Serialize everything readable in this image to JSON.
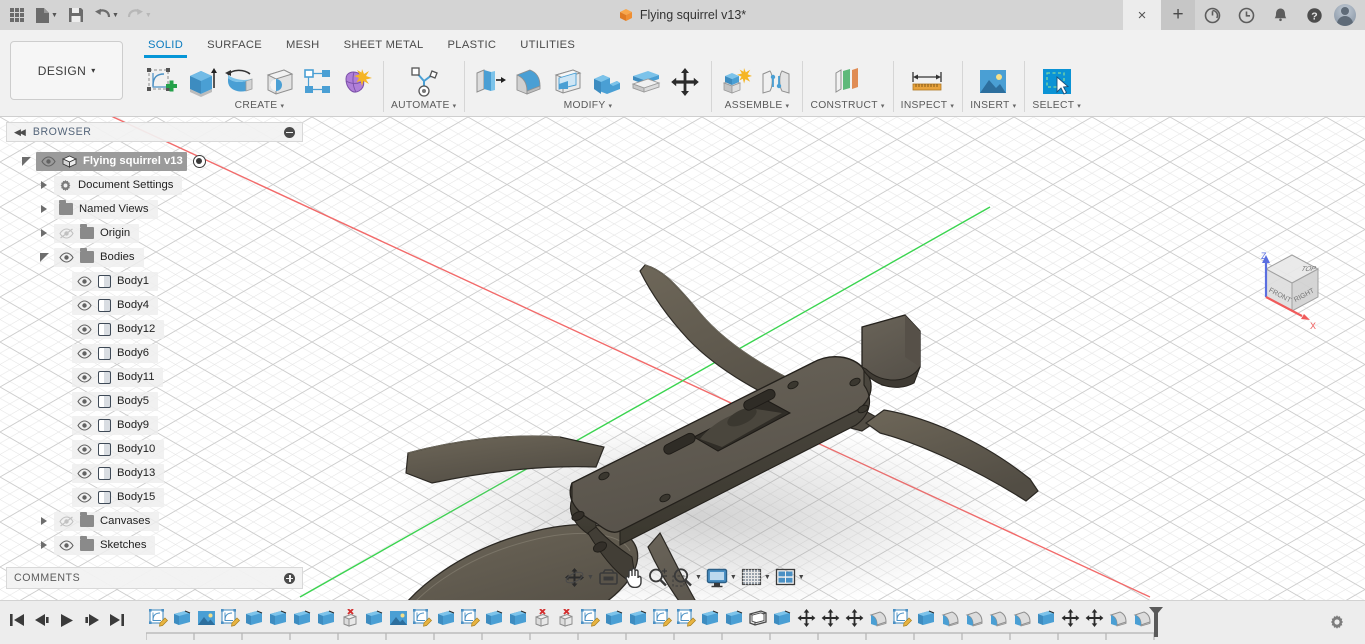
{
  "titlebar": {
    "app_grid_icon": "app-grid-icon",
    "new_doc_icon": "new-document-icon",
    "save_icon": "save-icon",
    "undo_icon": "undo-icon",
    "redo_icon": "redo-icon",
    "document_title": "Flying squirrel v13*",
    "doc_cube_icon": "fusion-cube-icon",
    "close_label": "×",
    "new_tab_label": "+",
    "icons": [
      "recent-activity-icon",
      "job-status-icon",
      "notifications-bell-icon",
      "help-question-icon",
      "user-avatar"
    ]
  },
  "ribbon": {
    "design_label": "DESIGN",
    "design_caret": "▾",
    "tabs": [
      {
        "label": "SOLID",
        "active": true
      },
      {
        "label": "SURFACE",
        "active": false
      },
      {
        "label": "MESH",
        "active": false
      },
      {
        "label": "SHEET METAL",
        "active": false
      },
      {
        "label": "PLASTIC",
        "active": false
      },
      {
        "label": "UTILITIES",
        "active": false
      }
    ],
    "groups": [
      {
        "label": "CREATE",
        "caret": "▾",
        "tools": [
          "create-sketch-icon",
          "extrude-icon",
          "revolve-icon",
          "sweep-icon",
          "pattern-icon",
          "form-icon"
        ]
      },
      {
        "label": "AUTOMATE",
        "caret": "▾",
        "tools": [
          "automate-icon"
        ]
      },
      {
        "label": "MODIFY",
        "caret": "▾",
        "tools": [
          "press-pull-icon",
          "fillet-icon",
          "shell-icon",
          "combine-icon",
          "offset-face-icon",
          "move-copy-icon"
        ]
      },
      {
        "label": "ASSEMBLE",
        "caret": "▾",
        "tools": [
          "new-component-icon",
          "joint-icon"
        ]
      },
      {
        "label": "CONSTRUCT",
        "caret": "▾",
        "tools": [
          "construct-plane-icon"
        ]
      },
      {
        "label": "INSPECT",
        "caret": "▾",
        "tools": [
          "measure-icon"
        ]
      },
      {
        "label": "INSERT",
        "caret": "▾",
        "tools": [
          "insert-image-icon"
        ]
      },
      {
        "label": "SELECT",
        "caret": "▾",
        "tools": [
          "select-window-icon"
        ]
      }
    ]
  },
  "browser": {
    "title": "BROWSER",
    "collapse_icon": "collapse-left-icon",
    "minimize_icon": "minimize-panel-icon",
    "tree": [
      {
        "label": "Flying squirrel v13",
        "level": 0,
        "expander": "open",
        "eye": "visible",
        "icon": "component-cube-icon",
        "root": true,
        "radio": true
      },
      {
        "label": "Document Settings",
        "level": 1,
        "expander": "closed",
        "eye": "none",
        "icon": "gear-icon"
      },
      {
        "label": "Named Views",
        "level": 1,
        "expander": "closed",
        "eye": "none",
        "icon": "folder-icon"
      },
      {
        "label": "Origin",
        "level": 1,
        "expander": "closed",
        "eye": "hidden",
        "icon": "folder-icon"
      },
      {
        "label": "Bodies",
        "level": 1,
        "expander": "open",
        "eye": "visible",
        "icon": "folder-icon"
      },
      {
        "label": "Body1",
        "level": 2,
        "expander": "none",
        "eye": "visible",
        "icon": "body-icon"
      },
      {
        "label": "Body4",
        "level": 2,
        "expander": "none",
        "eye": "visible",
        "icon": "body-icon"
      },
      {
        "label": "Body12",
        "level": 2,
        "expander": "none",
        "eye": "visible",
        "icon": "body-icon"
      },
      {
        "label": "Body6",
        "level": 2,
        "expander": "none",
        "eye": "visible",
        "icon": "body-icon"
      },
      {
        "label": "Body11",
        "level": 2,
        "expander": "none",
        "eye": "visible",
        "icon": "body-icon"
      },
      {
        "label": "Body5",
        "level": 2,
        "expander": "none",
        "eye": "visible",
        "icon": "body-icon"
      },
      {
        "label": "Body9",
        "level": 2,
        "expander": "none",
        "eye": "visible",
        "icon": "body-icon"
      },
      {
        "label": "Body10",
        "level": 2,
        "expander": "none",
        "eye": "visible",
        "icon": "body-icon"
      },
      {
        "label": "Body13",
        "level": 2,
        "expander": "none",
        "eye": "visible",
        "icon": "body-icon"
      },
      {
        "label": "Body15",
        "level": 2,
        "expander": "none",
        "eye": "visible",
        "icon": "body-icon"
      },
      {
        "label": "Canvases",
        "level": 1,
        "expander": "closed",
        "eye": "hidden",
        "icon": "folder-icon"
      },
      {
        "label": "Sketches",
        "level": 1,
        "expander": "closed",
        "eye": "visible",
        "icon": "folder-icon"
      }
    ]
  },
  "comments": {
    "title": "COMMENTS",
    "add_icon": "add-comment-icon"
  },
  "viewbar": {
    "items": [
      {
        "name": "orbit-icon",
        "caret": true
      },
      {
        "name": "look-at-icon",
        "caret": false
      },
      {
        "name": "pan-hand-icon",
        "caret": false
      },
      {
        "name": "zoom-icon",
        "caret": false
      },
      {
        "name": "zoom-window-icon",
        "caret": true
      },
      {
        "name": "display-settings-icon",
        "caret": true
      },
      {
        "name": "grid-snaps-icon",
        "caret": true
      },
      {
        "name": "viewports-icon",
        "caret": true
      }
    ]
  },
  "viewcube": {
    "faces": [
      "TOP",
      "FRONT",
      "RIGHT"
    ],
    "axis_z": "Z",
    "axis_x": "X"
  },
  "timeline": {
    "nav": [
      "go-to-beginning-icon",
      "step-back-icon",
      "play-icon",
      "step-forward-icon",
      "go-to-end-icon"
    ],
    "features": [
      "sketch",
      "extrude",
      "canvas",
      "sketch",
      "extrude",
      "extrude",
      "extrude",
      "extrude",
      "delete",
      "extrude",
      "canvas",
      "sketch",
      "extrude",
      "sketch",
      "extrude",
      "extrude",
      "delete",
      "delete",
      "sketch",
      "extrude",
      "extrude",
      "sketch",
      "sketch",
      "extrude",
      "extrude",
      "shell",
      "extrude",
      "move",
      "move",
      "move",
      "fillet",
      "sketch",
      "extrude",
      "fillet",
      "fillet",
      "fillet",
      "fillet",
      "extrude",
      "move",
      "move",
      "fillet",
      "fillet"
    ],
    "marker": "timeline-playhead",
    "settings_icon": "timeline-settings-gear-icon"
  },
  "colors": {
    "accent": "#0696d7",
    "tab_active_text": "#0a7bbf",
    "model_body": "#5c574f",
    "model_dark": "#4a463f",
    "axis_x": "#f05b5b",
    "axis_y": "#35d04a",
    "canvas_bg": "#ffffff",
    "grid_line": "#c9c9c9",
    "ribbon_bg": "#f1f1f1",
    "titlebar_bg": "#d4d4d4",
    "timeline_bg": "#ededed"
  }
}
